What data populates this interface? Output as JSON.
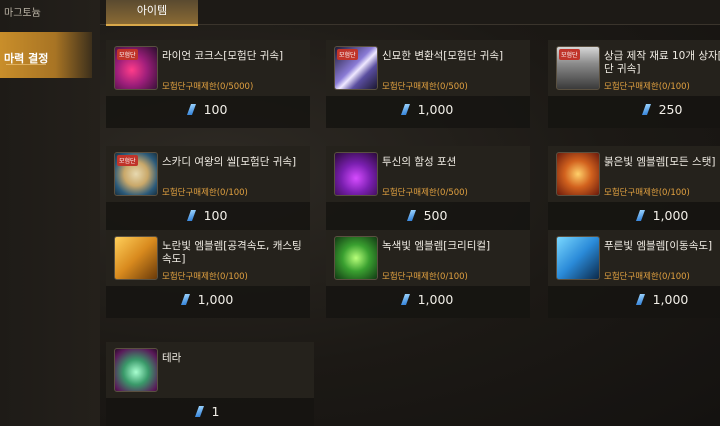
{
  "sidebar": {
    "top_label": "마그토늄",
    "selected_label": "마력 결정"
  },
  "tabs": [
    {
      "label": "아이템"
    }
  ],
  "items": [
    {
      "name": "라이언 코크스[모험단 귀속]",
      "limit": "모험단구매제한(0/5000)",
      "price": "100",
      "icon": "ryan-coke-icon"
    },
    {
      "name": "신묘한 변환석[모험단 귀속]",
      "limit": "모험단구매제한(0/500)",
      "price": "1,000",
      "icon": "conversion-stone-icon"
    },
    {
      "name": "상급 제작 재료 10개 상자[모험단 귀속]",
      "limit": "모험단구매제한(0/100)",
      "price": "250",
      "icon": "material-box-icon"
    },
    {
      "name": "스카디 여왕의 씰[모험단 귀속]",
      "limit": "모험단구매제한(0/100)",
      "price": "100",
      "icon": "skadi-seal-icon"
    },
    {
      "name": "투신의 함성 포션",
      "limit": "모험단구매제한(0/500)",
      "price": "500",
      "icon": "potion-icon"
    },
    {
      "name": "붉은빛 엠블렘[모든 스탯]",
      "limit": "모험단구매제한(0/100)",
      "price": "1,000",
      "icon": "red-emblem-icon"
    },
    {
      "name": "노란빛 엠블렘[공격속도, 캐스팅속도]",
      "limit": "모험단구매제한(0/100)",
      "price": "1,000",
      "icon": "yellow-emblem-icon"
    },
    {
      "name": "녹색빛 엠블렘[크리티컬]",
      "limit": "모험단구매제한(0/100)",
      "price": "1,000",
      "icon": "green-emblem-icon"
    },
    {
      "name": "푸른빛 엠블렘[이동속도]",
      "limit": "모험단구매제한(0/100)",
      "price": "1,000",
      "icon": "blue-emblem-icon"
    },
    {
      "name": "테라",
      "limit": "",
      "price": "1",
      "icon": "terra-icon"
    }
  ],
  "badge_label": "모험단",
  "currency_icon": "mana-crystal-icon"
}
